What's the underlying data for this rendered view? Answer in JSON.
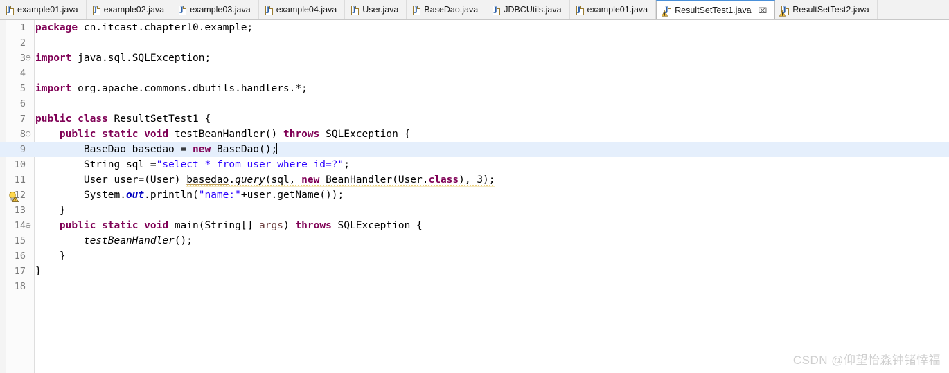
{
  "window": {
    "app": "Eclipse IDE Java Editor"
  },
  "tabs": [
    {
      "label": "example01.java",
      "icon": "java-file-icon",
      "active": false,
      "warning": false,
      "closable": false
    },
    {
      "label": "example02.java",
      "icon": "java-file-icon",
      "active": false,
      "warning": false,
      "closable": false
    },
    {
      "label": "example03.java",
      "icon": "java-file-icon",
      "active": false,
      "warning": false,
      "closable": false
    },
    {
      "label": "example04.java",
      "icon": "java-file-icon",
      "active": false,
      "warning": false,
      "closable": false
    },
    {
      "label": "User.java",
      "icon": "java-file-icon",
      "active": false,
      "warning": false,
      "closable": false
    },
    {
      "label": "BaseDao.java",
      "icon": "java-file-icon",
      "active": false,
      "warning": false,
      "closable": false
    },
    {
      "label": "JDBCUtils.java",
      "icon": "java-file-icon",
      "active": false,
      "warning": false,
      "closable": false
    },
    {
      "label": "example01.java",
      "icon": "java-file-icon",
      "active": false,
      "warning": false,
      "closable": false
    },
    {
      "label": "ResultSetTest1.java",
      "icon": "java-file-warning-icon",
      "active": true,
      "warning": true,
      "closable": true,
      "close_glyph": "⌧"
    },
    {
      "label": "ResultSetTest2.java",
      "icon": "java-file-warning-icon",
      "active": false,
      "warning": true,
      "closable": false
    }
  ],
  "editor": {
    "active_file": "ResultSetTest1.java",
    "current_line": 9,
    "line_numbers": [
      "1",
      "2",
      "3",
      "4",
      "5",
      "6",
      "7",
      "8",
      "9",
      "10",
      "11",
      "12",
      "13",
      "14",
      "15",
      "16",
      "17",
      "18"
    ],
    "fold_markers": {
      "3": "⊖",
      "8": "⊖",
      "14": "⊖"
    },
    "warning_marker_line": 11,
    "change_bar_lines": [
      8,
      9,
      10,
      11,
      12,
      13
    ],
    "lines_text": [
      "package cn.itcast.chapter10.example;",
      "",
      "import java.sql.SQLException;",
      "",
      "import org.apache.commons.dbutils.handlers.*;",
      "",
      "public class ResultSetTest1 {",
      "    public static void testBeanHandler() throws SQLException {",
      "        BaseDao basedao = new BaseDao();",
      "        String sql =\"select * from user where id=?\";",
      "        User user=(User) basedao.query(sql, new BeanHandler(User.class), 3);",
      "        System.out.println(\"name:\"+user.getName());",
      "    }",
      "    public static void main(String[] args) throws SQLException {",
      "        testBeanHandler();",
      "    }",
      "}",
      ""
    ],
    "tokens": {
      "l1_kw": "package",
      "l1_rest": " cn.itcast.chapter10.example;",
      "l3_kw": "import",
      "l3_rest": " java.sql.SQLException;",
      "l5_kw": "import",
      "l5_rest": " org.apache.commons.dbutils.handlers.*;",
      "l7_kw1": "public",
      "l7_kw2": "class",
      "l7_rest": " ResultSetTest1 {",
      "l8_indent": "    ",
      "l8_kw1": "public",
      "l8_kw2": "static",
      "l8_kw3": "void",
      "l8_mid": " testBeanHandler() ",
      "l8_kw4": "throws",
      "l8_rest": " SQLException {",
      "l9_indent": "        ",
      "l9_a": "BaseDao basedao = ",
      "l9_kw": "new",
      "l9_b": " BaseDao();",
      "l10_indent": "        ",
      "l10_a": "String sql =",
      "l10_str": "\"select * from user where id=?\"",
      "l10_b": ";",
      "l11_indent": "        ",
      "l11_a": "User user=(User) ",
      "l11_var": "basedao",
      "l11_b": ".",
      "l11_method": "query",
      "l11_c": "(sql, ",
      "l11_kw": "new",
      "l11_d": " BeanHandler(User.",
      "l11_kw2": "class",
      "l11_e": "), 3);",
      "l12_indent": "        ",
      "l12_a": "System.",
      "l12_field": "out",
      "l12_b": ".println(",
      "l12_str": "\"name:\"",
      "l12_c": "+user.getName());",
      "l13": "    }",
      "l14_indent": "    ",
      "l14_kw1": "public",
      "l14_kw2": "static",
      "l14_kw3": "void",
      "l14_a": " main(String[] ",
      "l14_param": "args",
      "l14_b": ") ",
      "l14_kw4": "throws",
      "l14_c": " SQLException {",
      "l15_indent": "        ",
      "l15_method": "testBeanHandler",
      "l15_rest": "();",
      "l16": "    }",
      "l17": "}"
    }
  },
  "watermark": {
    "text": "CSDN @仰望怡淼钟锗悻福"
  },
  "colors": {
    "keyword": "#7f0055",
    "string": "#2a00ff",
    "field": "#0000c0",
    "parameter": "#6a3e3e",
    "current_line_bg": "#e5effc",
    "tabbar_bg": "#f2f2f2",
    "active_tab_border": "#4a90d9",
    "warning_squiggle": "#d8a400",
    "gutter_text": "#7a7a7a",
    "watermark": "#cfcfcf"
  }
}
